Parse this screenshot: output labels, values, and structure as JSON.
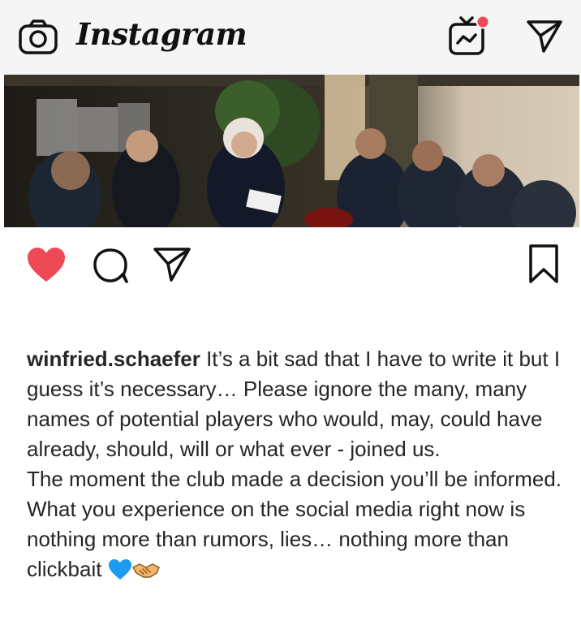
{
  "app": {
    "logo_text": "Instagram"
  },
  "icons": {
    "camera": "camera-icon",
    "igtv": "igtv-icon",
    "direct": "direct-message-icon",
    "like": "heart-icon",
    "comment": "comment-icon",
    "share": "share-icon",
    "save": "bookmark-icon"
  },
  "colors": {
    "like_active": "#ed4956",
    "notification_dot": "#ed4956",
    "heart_emoji": "#1d9bf0"
  },
  "post": {
    "state": {
      "liked": true
    },
    "caption": {
      "username": "winfried.schaefer",
      "paragraph1": " It’s a bit sad that I have to write it but I guess it’s necessary… Please ignore the many, many names of potential players who would, may, could have already, should, will or what ever - joined us.",
      "paragraph2": "The moment the club made a decision you’ll be informed. What you experience on the social media right now is nothing more than rumors, lies… nothing more than clickbait "
    }
  }
}
